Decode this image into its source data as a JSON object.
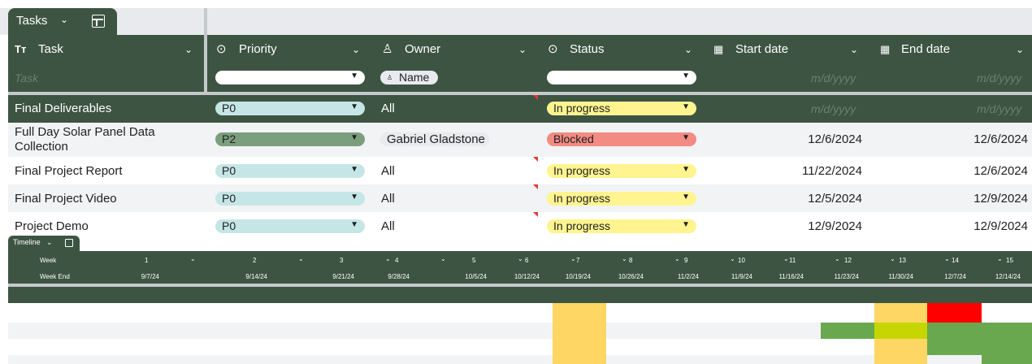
{
  "tab": {
    "title": "Tasks",
    "chevron": "⌄",
    "icon": "table-icon"
  },
  "columns": {
    "task": {
      "icon": "Tт",
      "label": "Task"
    },
    "priority": {
      "icon": "⊙",
      "label": "Priority"
    },
    "owner": {
      "icon": "♙",
      "label": "Owner"
    },
    "status": {
      "icon": "⊙",
      "label": "Status"
    },
    "start": {
      "icon": "▦",
      "label": "Start date"
    },
    "end": {
      "icon": "▦",
      "label": "End date"
    }
  },
  "filters": {
    "task_placeholder": "Task",
    "owner_chip": "Name",
    "date_placeholder": "m/d/yyyy"
  },
  "rows": [
    {
      "task": "Final Deliverables",
      "priority": "P0",
      "owner": "All",
      "status": "In progress",
      "start": "m/d/yyyy",
      "end": "m/d/yyyy"
    },
    {
      "task": "Full Day Solar Panel Data Collection",
      "priority": "P2",
      "owner": "Gabriel Gladstone",
      "status": "Blocked",
      "start": "12/6/2024",
      "end": "12/6/2024"
    },
    {
      "task": "Final Project Report",
      "priority": "P0",
      "owner": "All",
      "status": "In progress",
      "start": "11/22/2024",
      "end": "12/6/2024"
    },
    {
      "task": "Final Project Video",
      "priority": "P0",
      "owner": "All",
      "status": "In progress",
      "start": "12/5/2024",
      "end": "12/9/2024"
    },
    {
      "task": "Project Demo",
      "priority": "P0",
      "owner": "All",
      "status": "In progress",
      "start": "12/9/2024",
      "end": "12/9/2024"
    }
  ],
  "timeline": {
    "title": "Timeline",
    "week_label": "Week",
    "week_end_label": "Week End",
    "weeks": [
      "1",
      "2",
      "3",
      "4",
      "5",
      "6",
      "7",
      "8",
      "9",
      "10",
      "11",
      "12",
      "13",
      "14",
      "15"
    ],
    "week_ends": [
      "9/7/24",
      "9/14/24",
      "9/21/24",
      "9/28/24",
      "10/5/24",
      "10/12/24",
      "10/19/24",
      "10/26/24",
      "11/2/24",
      "11/9/24",
      "11/16/24",
      "11/23/24",
      "11/30/24",
      "12/7/24",
      "12/14/24"
    ]
  },
  "colors": {
    "header": "#3d5442",
    "p0": "#c5e6e6",
    "p2": "#7a9e7e",
    "in_progress": "#fff48f",
    "blocked": "#f28b82",
    "gantt_yellow": "#fdd663",
    "gantt_green": "#6aa84f",
    "gantt_lime": "#c5d600",
    "gantt_red": "#ff0000"
  }
}
